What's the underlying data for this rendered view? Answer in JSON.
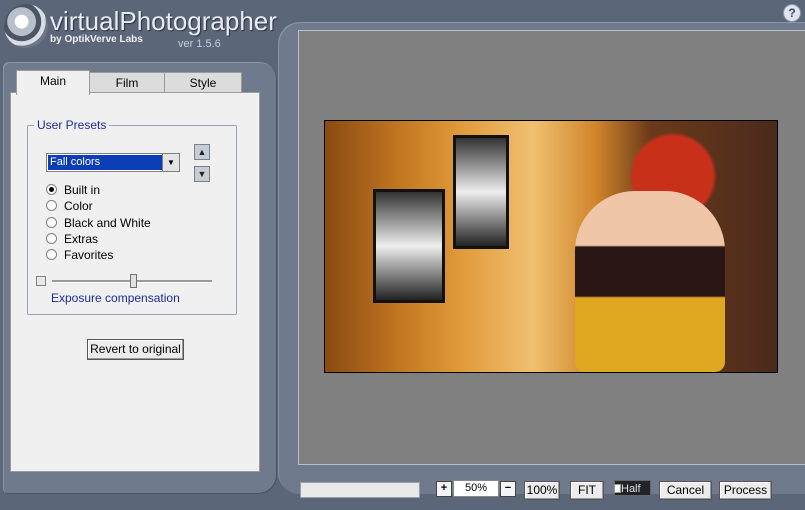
{
  "header": {
    "title": "virtualPhotographer",
    "subtitle": "by OptikVerve Labs",
    "version": "ver 1.5.6",
    "help_label": "?"
  },
  "tabs": [
    {
      "label": "Main",
      "active": true
    },
    {
      "label": "Film",
      "active": false
    },
    {
      "label": "Style",
      "active": false
    }
  ],
  "main": {
    "group_label": "User Presets",
    "preset_selected": "Fall colors",
    "radios": [
      {
        "label": "Built in",
        "checked": true
      },
      {
        "label": "Color",
        "checked": false
      },
      {
        "label": "Black and White",
        "checked": false
      },
      {
        "label": "Extras",
        "checked": false
      },
      {
        "label": "Favorites",
        "checked": false
      }
    ],
    "exposure_label": "Exposure compensation",
    "exposure_value": 0.5,
    "revert_label": "Revert to original"
  },
  "bottom": {
    "plus_label": "+",
    "zoom_value": "50%",
    "minus_label": "−",
    "zoom100_label": "100%",
    "fit_label": "FIT",
    "half_label": "Half",
    "cancel_label": "Cancel",
    "process_label": "Process"
  },
  "colors": {
    "frame": "#6f7a8c",
    "background": "#5b6678",
    "selection": "#0a3db6",
    "label_blue": "#1c2c9a"
  }
}
